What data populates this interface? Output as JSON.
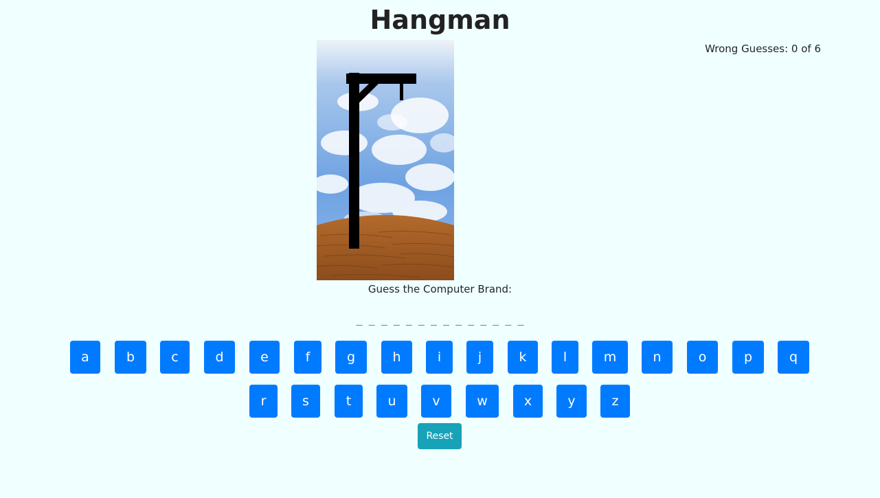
{
  "title": "Hangman",
  "status": {
    "wrong_guesses": "Wrong Guesses: 0 of 6",
    "wrong_count": 0,
    "max_wrong": 6
  },
  "prompt": "Guess the Computer Brand:",
  "word_display": "_ _ _ _ _ _ _ _ _ _ _ _ _ _",
  "keyboard": {
    "row1": [
      "a",
      "b",
      "c",
      "d",
      "e",
      "f",
      "g",
      "h",
      "i",
      "j",
      "k",
      "l",
      "m",
      "n",
      "o",
      "p",
      "q"
    ],
    "row2": [
      "r",
      "s",
      "t",
      "u",
      "v",
      "w",
      "x",
      "y",
      "z"
    ]
  },
  "reset_label": "Reset",
  "colors": {
    "background": "#f0ffff",
    "letter_button": "#007bff",
    "reset_button": "#17a2b8",
    "gallows": "#000000"
  },
  "scene": {
    "icon": "gallows-image"
  }
}
